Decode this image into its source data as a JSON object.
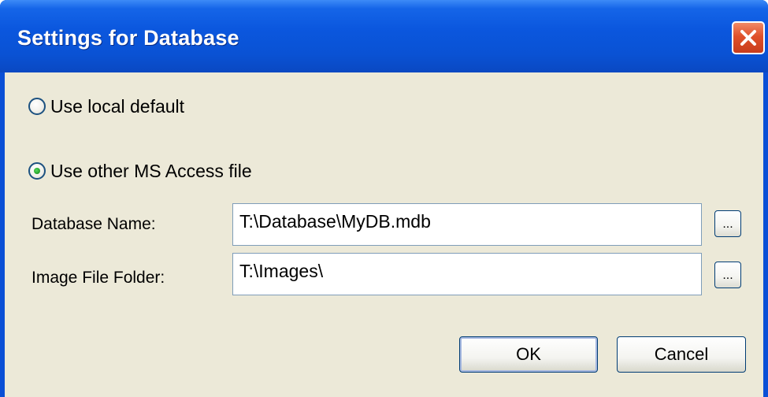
{
  "window": {
    "title": "Settings for Database"
  },
  "options": {
    "local_default": {
      "label": "Use local default",
      "selected": false
    },
    "other_access_file": {
      "label": "Use other MS Access file",
      "selected": true
    }
  },
  "fields": {
    "database_name": {
      "label": "Database Name:",
      "value": "T:\\Database\\MyDB.mdb",
      "browse_label": "..."
    },
    "image_folder": {
      "label": "Image File Folder:",
      "value": "T:\\Images\\",
      "browse_label": "..."
    }
  },
  "buttons": {
    "ok": "OK",
    "cancel": "Cancel"
  },
  "colors": {
    "titlebar": "#0a52d4",
    "close": "#e0502a",
    "client": "#ece9d8",
    "radio_dot": "#2aa52f"
  }
}
